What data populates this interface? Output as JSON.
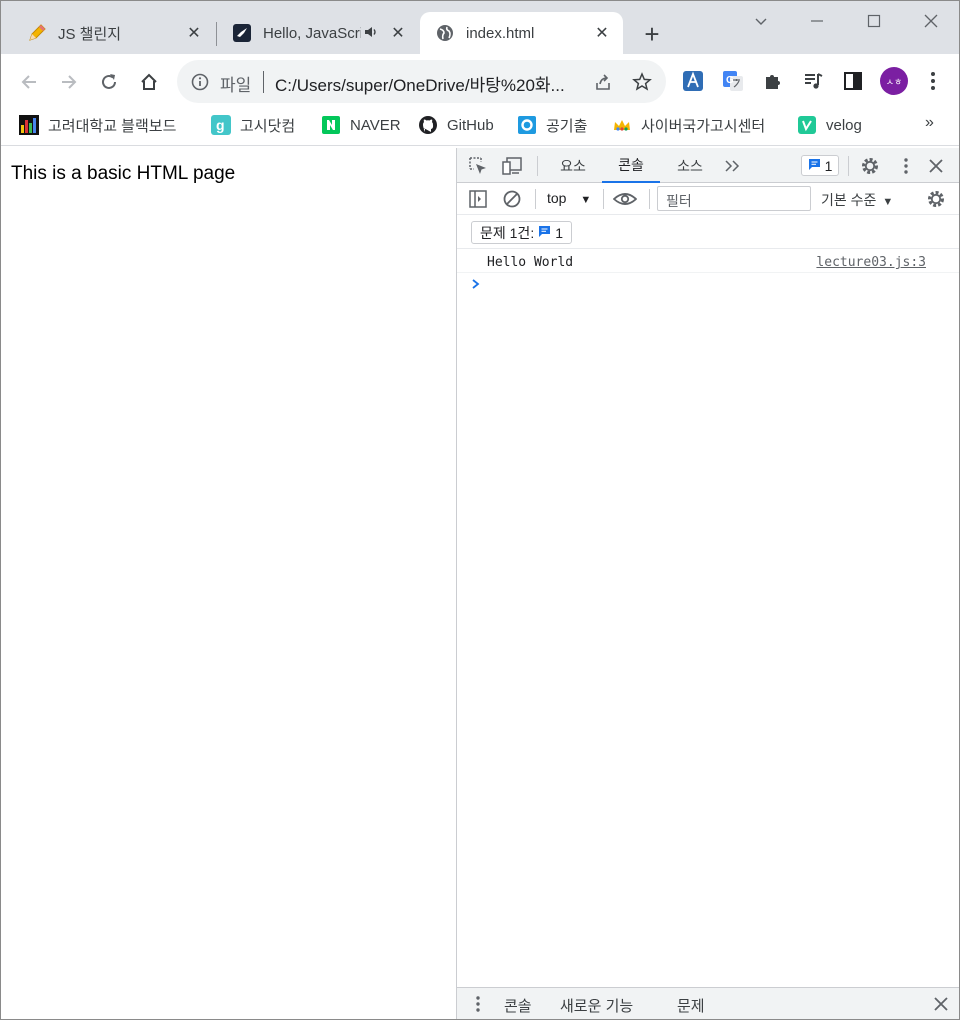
{
  "tabs": [
    {
      "title": "JS 챌린지",
      "favicon": "pencil-icon",
      "active": false
    },
    {
      "title": "Hello, JavaScri",
      "favicon": "bird-icon",
      "active": false,
      "audio": true
    },
    {
      "title": "index.html",
      "favicon": "globe-icon",
      "active": true
    }
  ],
  "omnibox": {
    "scheme_label": "파일",
    "url": "C:/Users/super/OneDrive/바탕%20화..."
  },
  "profile": {
    "initials": "ㅅㅎ",
    "color": "#7b1fa2"
  },
  "bookmarks": [
    {
      "label": "고려대학교 블랙보드",
      "icon": "bar-chart-icon"
    },
    {
      "label": "고시닷컴",
      "icon": "g-logo-icon"
    },
    {
      "label": "NAVER",
      "icon": "naver-logo-icon"
    },
    {
      "label": "GitHub",
      "icon": "github-icon"
    },
    {
      "label": "공기출",
      "icon": "ring-icon"
    },
    {
      "label": "사이버국가고시센터",
      "icon": "crown-icon"
    },
    {
      "label": "velog",
      "icon": "velog-icon"
    }
  ],
  "bookmarks_more": "»",
  "page": {
    "text": "This is a basic HTML page"
  },
  "devtools": {
    "tabs": [
      "요소",
      "콘솔",
      "소스"
    ],
    "active_tab": "콘솔",
    "issues_count": "1",
    "context": "top",
    "filter_placeholder": "필터",
    "levels_label": "기본 수준",
    "issues_label": "문제 1건:",
    "issues_chip_count": "1",
    "log": {
      "message": "Hello World",
      "source": "lecture03.js:3"
    },
    "drawer_tabs": [
      "콘솔",
      "새로운 기능",
      "문제"
    ]
  },
  "colors": {
    "accent": "#1a73e8",
    "tabstrip": "#dee1e6",
    "profile": "#7b1fa2"
  }
}
